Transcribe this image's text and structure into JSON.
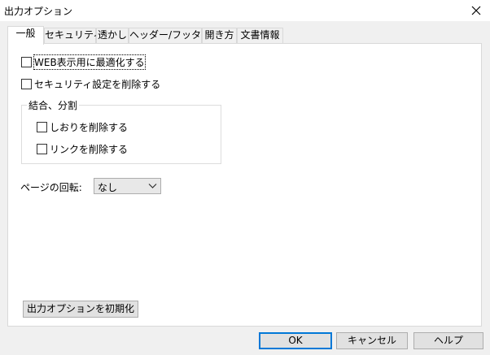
{
  "window": {
    "title": "出力オプション"
  },
  "tabs": [
    {
      "label": "一般",
      "active": true
    },
    {
      "label": "セキュリティ"
    },
    {
      "label": "透かし"
    },
    {
      "label": "ヘッダー/フッター"
    },
    {
      "label": "開き方"
    },
    {
      "label": "文書情報"
    }
  ],
  "general": {
    "optimize_web": {
      "label": "WEB表示用に最適化する",
      "checked": false
    },
    "remove_security": {
      "label": "セキュリティ設定を削除する",
      "checked": false
    },
    "merge_split": {
      "legend": "結合、分割",
      "remove_bookmarks": {
        "label": "しおりを削除する",
        "checked": false
      },
      "remove_links": {
        "label": "リンクを削除する",
        "checked": false
      }
    },
    "page_rotation": {
      "label": "ページの回転:",
      "value": "なし"
    },
    "reset_button": "出力オプションを初期化"
  },
  "footer": {
    "ok": "OK",
    "cancel": "キャンセル",
    "help": "ヘルプ"
  }
}
